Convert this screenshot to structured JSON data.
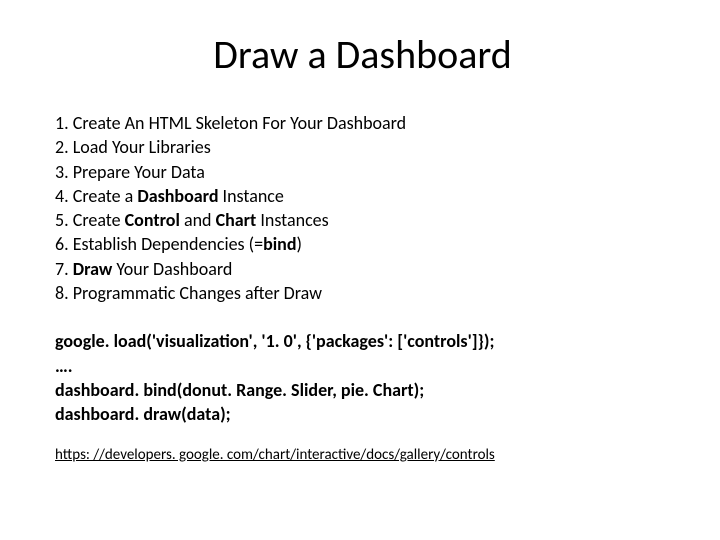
{
  "title": "Draw a Dashboard",
  "steps": {
    "s1_prefix": "1. Create An HTML Skeleton For Your Dashboard",
    "s2_prefix": "2. Load Your Libraries",
    "s3_prefix": "3. Prepare Your Data",
    "s4_a": "4. Create a ",
    "s4_b": "Dashboard",
    "s4_c": " Instance",
    "s5_a": "5. Create ",
    "s5_b": "Control",
    "s5_c": " and ",
    "s5_d": "Chart",
    "s5_e": " Instances",
    "s6_a": "6. Establish Dependencies (=",
    "s6_b": "bind",
    "s6_c": ")",
    "s7_a": "7. ",
    "s7_b": "Draw",
    "s7_c": " Your Dashboard",
    "s8_prefix": "8. Programmatic Changes after Draw"
  },
  "code": {
    "line1": "google. load('visualization', '1. 0', {'packages': ['controls']});",
    "line2": "….",
    "line3": "dashboard. bind(donut. Range. Slider, pie. Chart);",
    "line4": "dashboard. draw(data);"
  },
  "link": "https: //developers. google. com/chart/interactive/docs/gallery/controls"
}
